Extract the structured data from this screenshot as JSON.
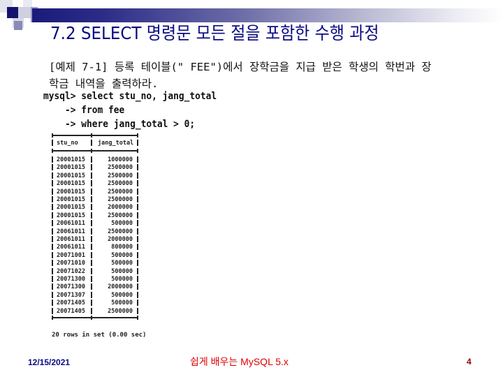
{
  "slide": {
    "title": "7.2  SELECT 명령문 모든 절을 포함한 수행 과정",
    "description_line1": "[예제 7-1] 등록 테이블(\" FEE\")에서 장학금을 지급 받은 학생의 학번과 장",
    "description_line2": "학금 내역을 출력하라.",
    "code_lines": [
      "mysql> select stu_no, jang_total",
      "    -> from fee",
      "    -> where jang_total > 0;"
    ],
    "result_table": {
      "columns": [
        "stu_no",
        "jang_total"
      ],
      "rows": [
        [
          "20001015",
          "1000000"
        ],
        [
          "20001015",
          "2500000"
        ],
        [
          "20001015",
          "2500000"
        ],
        [
          "20001015",
          "2500000"
        ],
        [
          "20001015",
          "2500000"
        ],
        [
          "20001015",
          "2500000"
        ],
        [
          "20001015",
          "2000000"
        ],
        [
          "20001015",
          "2500000"
        ],
        [
          "20061011",
          "500000"
        ],
        [
          "20061011",
          "2500000"
        ],
        [
          "20061011",
          "2000000"
        ],
        [
          "20061011",
          "800000"
        ],
        [
          "20071001",
          "500000"
        ],
        [
          "20071010",
          "500000"
        ],
        [
          "20071022",
          "500000"
        ],
        [
          "20071300",
          "500000"
        ],
        [
          "20071300",
          "2000000"
        ],
        [
          "20071307",
          "500000"
        ],
        [
          "20071405",
          "500000"
        ],
        [
          "20071405",
          "2500000"
        ]
      ],
      "footer": "20 rows in set (0.00 sec)"
    },
    "footer": {
      "date": "12/15/2021",
      "center": "쉽게 배우는 MySQL 5.x",
      "page": "4"
    },
    "colors": {
      "title": "#0a0a82",
      "footer_center": "#e00000",
      "footer_page": "#8a0000",
      "accent_dark": "#1a1a7a"
    }
  }
}
